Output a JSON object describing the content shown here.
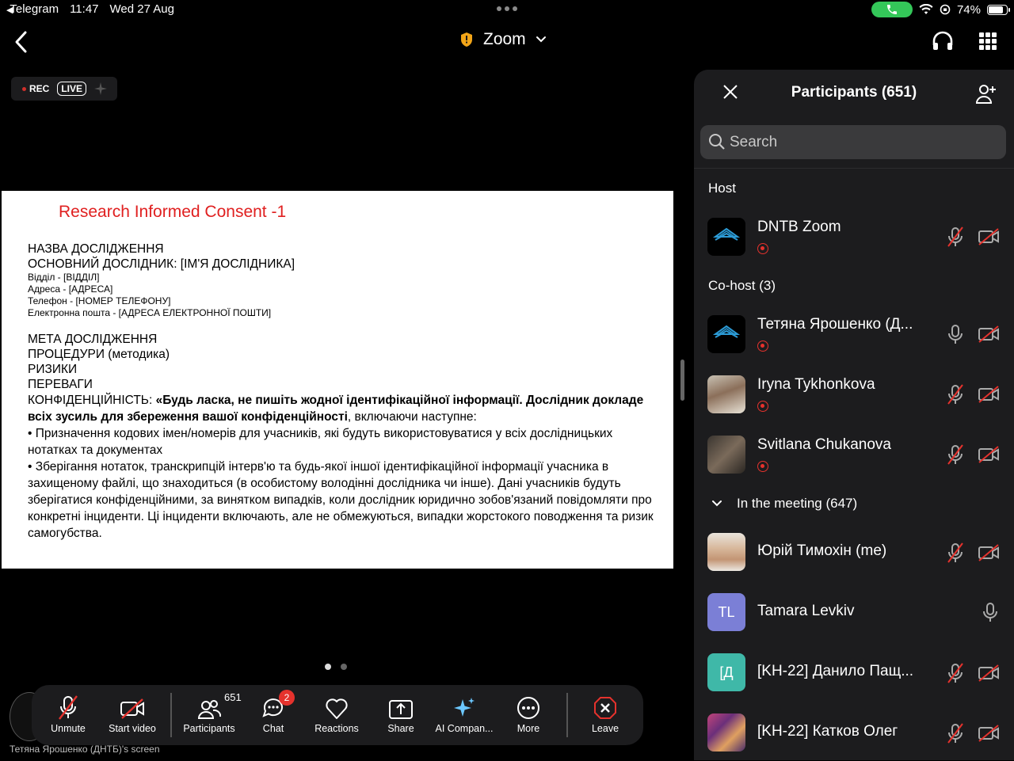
{
  "status_bar": {
    "back_app": "Telegram",
    "time": "11:47",
    "date": "Wed 27 Aug",
    "battery": "74%",
    "battery_level": 0.74
  },
  "nav": {
    "title": "Zoom"
  },
  "share": {
    "rec_label": "REC",
    "live_label": "LIVE",
    "screen_label": "Тетяна Ярошенко (ДНТБ)'s screen",
    "page_count": 2,
    "current_page": 1
  },
  "slide": {
    "title": "Research Informed Consent -1",
    "study_name": "НАЗВА ДОСЛІДЖЕННЯ",
    "main_researcher": "ОСНОВНИЙ ДОСЛІДНИК:   [ІМ'Я ДОСЛІДНИКА]",
    "department": "Відділ - [ВІДДІЛ]",
    "address": "Адреса - [АДРЕСА]",
    "phone": "Телефон - [НОМЕР ТЕЛЕФОНУ]",
    "email": "Електронна пошта - [АДРЕСА ЕЛЕКТРОННОЇ ПОШТИ]",
    "goal": "МЕТА ДОСЛІДЖЕННЯ",
    "procedures": "ПРОЦЕДУРИ (методика)",
    "risks": "РИЗИКИ",
    "benefits": "ПЕРЕВАГИ",
    "confidentiality_label": "КОНФІДЕНЦІЙНІСТЬ: ",
    "confidentiality_bold": "«Будь ласка, не пишіть жодної ідентифікаційної інформації. Дослідник докладе всіх зусиль для збереження вашої конфіденційності",
    "confidentiality_rest": ", включаючи наступне:",
    "bullet1": "• Призначення кодових імен/номерів для учасників, які будуть використовуватися у всіх дослідницьких нотатках та документах",
    "bullet2": "• Зберігання нотаток, транскрипцій інтерв'ю та будь-якої іншої ідентифікаційної інформації учасника в захищеному файлі, що знаходиться (в особистому володінні дослідника чи інше). Дані учасників будуть зберігатися конфіденційними, за винятком випадків, коли дослідник юридично зобов'язаний повідомляти про конкретні інциденти. Ці інциденти включають, але не обмежуються, випадки жорстокого поводження та ризик самогубства."
  },
  "toolbar": {
    "unmute": "Unmute",
    "start_video": "Start video",
    "participants": "Participants",
    "participants_count": "651",
    "chat": "Chat",
    "chat_badge": "2",
    "reactions": "Reactions",
    "share": "Share",
    "ai": "AI Compan...",
    "more": "More",
    "leave": "Leave"
  },
  "panel": {
    "title": "Participants (651)",
    "search_placeholder": "Search",
    "host_section": "Host",
    "cohost_section": "Co-host (3)",
    "meeting_section": "In the meeting (647)",
    "host": {
      "name": "DNTB Zoom"
    },
    "cohosts": [
      {
        "name": "Тетяна Ярошенко (Д..."
      },
      {
        "name": "Iryna Tykhonkova"
      },
      {
        "name": "Svitlana Chukanova"
      }
    ],
    "attendees": [
      {
        "name": "Юрій Тимохін (me)"
      },
      {
        "name": "Tamara Levkiv",
        "initials": "TL"
      },
      {
        "name": "[KH-22] Данило Пащ...",
        "initials": "[Д"
      },
      {
        "name": "[KH-22] Катков Олег"
      }
    ]
  },
  "colors": {
    "accent_red": "#e5322d",
    "slide_title": "#e02020",
    "call_green": "#34c759",
    "avatar_tl": "#7b7fd6",
    "avatar_d": "#3fb8a8"
  }
}
